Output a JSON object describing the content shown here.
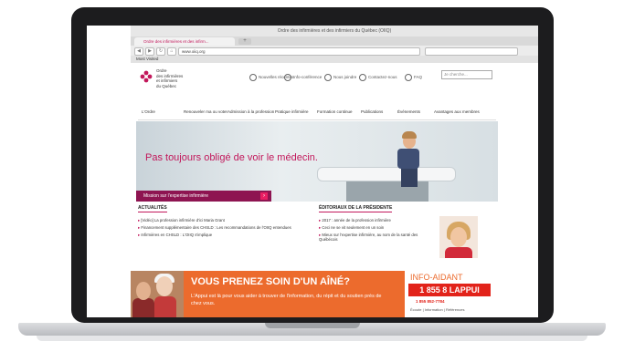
{
  "browser": {
    "window_title": "Ordre des infirmières et des infirmiers du Québec (OIIQ)",
    "tab_title": "Ordre des infirmières et des infirm...",
    "new_tab": "+",
    "url": "www.oiiq.org",
    "bookmarks_label": "Most Visited"
  },
  "site": {
    "logo_lines": [
      "Ordre",
      "des infirmières",
      "et infirmiers",
      "du Québec"
    ],
    "util": [
      "Nouvelles récentes",
      "Info-conférence",
      "Nous joindre",
      "Contactez-nous",
      "FAQ"
    ],
    "search_placeholder": "Je cherche...",
    "menu": [
      "L'Ordre",
      "Renouveler ma ou voter",
      "Admission à la profession",
      "Pratique infirmière",
      "Formation continue",
      "Publications",
      "Événements",
      "Avantages aux membres"
    ],
    "hero_text": "Pas toujours obligé de voir le médecin.",
    "mission_label": "Mission sur l'expertise infirmière",
    "mission_arrow": "›",
    "news_title": "ACTUALITÉS",
    "news_items": [
      "[Vidéo] La profession infirmière d'ici Maria Grant",
      "Financement supplémentaire des CHSLD : Les recommandations de l'OIIQ entendues",
      "Infirmières en CHSLD : L'OIIQ s'implique"
    ],
    "editorial_title": "ÉDITORIAUX DE LA PRÉSIDENTE",
    "editorial_items": [
      "2017 : année de la profession infirmière",
      "Ceci ne se vit seulement en un soin",
      "Mieux sur l'expertise infirmière, au nom de la santé des Québécois"
    ]
  },
  "banner": {
    "title": "VOUS PRENEZ SOIN D'UN AÎNÉ?",
    "subtitle": "L'Appui est là pour vous aider à trouver de l'information, du répit et du soutien près de chez vous.",
    "ia_title": "INFO-AIDANT",
    "ia_phone": "1 855 8 LAPPUI",
    "ia_alt": "1 855 852-7784",
    "ia_links": "Écoute | Information | Références"
  }
}
